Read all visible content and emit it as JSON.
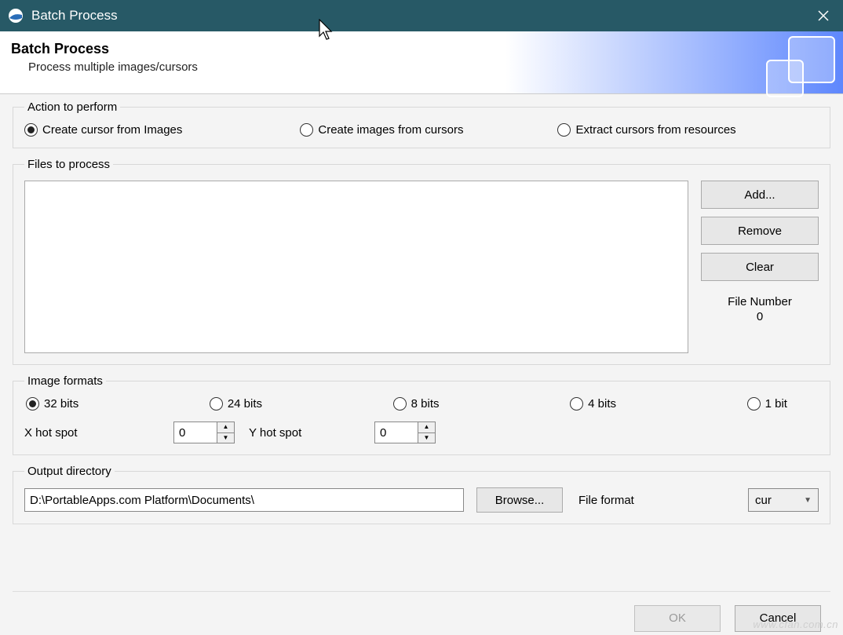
{
  "titlebar": {
    "title": "Batch Process"
  },
  "header": {
    "title": "Batch Process",
    "subtitle": "Process multiple images/cursors"
  },
  "action": {
    "legend": "Action to perform",
    "opt1": "Create cursor from Images",
    "opt2": "Create images from cursors",
    "opt3": "Extract cursors from resources",
    "selected": 0
  },
  "files": {
    "legend": "Files to process",
    "add": "Add...",
    "remove": "Remove",
    "clear": "Clear",
    "count_label": "File Number",
    "count_value": "0"
  },
  "formats": {
    "legend": "Image formats",
    "b32": "32 bits",
    "b24": "24 bits",
    "b8": "8 bits",
    "b4": "4 bits",
    "b1": "1 bit",
    "selected": 0,
    "x_label": "X hot spot",
    "y_label": "Y hot spot",
    "x_value": "0",
    "y_value": "0"
  },
  "output": {
    "legend": "Output directory",
    "path": "D:\\PortableApps.com Platform\\Documents\\",
    "browse": "Browse...",
    "ff_label": "File format",
    "ff_value": "cur"
  },
  "buttons": {
    "ok": "OK",
    "cancel": "Cancel"
  },
  "watermark": "www.cfan.com.cn"
}
